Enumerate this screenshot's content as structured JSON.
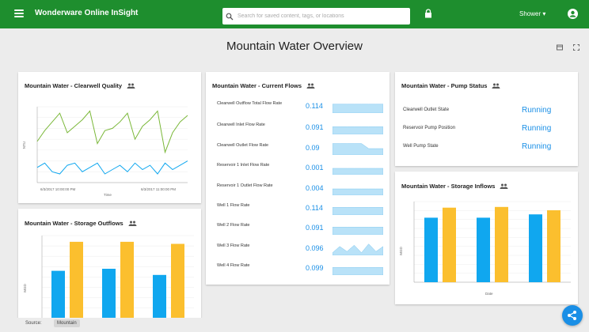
{
  "header": {
    "app_title": "Wonderware Online InSight",
    "search_placeholder": "Search for saved content, tags, or locations",
    "user_label": "Shower ▾"
  },
  "page": {
    "title": "Mountain Water Overview"
  },
  "clearwell_card": {
    "title": "Mountain Water - Clearwell Quality",
    "ylabel": "NTU",
    "x_start": "6/3/2017 10:00:00 PM",
    "x_end": "6/3/2017 11:00:00 PM",
    "xlabel": "Time"
  },
  "current_flows_card": {
    "title": "Mountain Water - Current Flows",
    "rows": [
      {
        "label": "Clearwell Outflow Total Flow Rate",
        "value": "0.114"
      },
      {
        "label": "Clearwell Inlet Flow Rate",
        "value": "0.091"
      },
      {
        "label": "Clearwell Outlet Flow Rate",
        "value": "0.09"
      },
      {
        "label": "Reservoir 1 Inlet Flow Rate",
        "value": "0.001"
      },
      {
        "label": "Reservoir 1 Outlet Flow Rate",
        "value": "0.004"
      },
      {
        "label": "Well 1 Flow Rate",
        "value": "0.114"
      },
      {
        "label": "Well 2 Flow Rate",
        "value": "0.091"
      },
      {
        "label": "Well 3 Flow Rate",
        "value": "0.096"
      },
      {
        "label": "Well 4 Flow Rate",
        "value": "0.099"
      }
    ]
  },
  "pump_status_card": {
    "title": "Mountain Water - Pump Status",
    "rows": [
      {
        "label": "Clearwell Outlet State",
        "value": "Running"
      },
      {
        "label": "Reservoir Pump Position",
        "value": "Running"
      },
      {
        "label": "Well Pump State",
        "value": "Running"
      }
    ]
  },
  "storage_outflows_card": {
    "title": "Mountain Water - Storage Outflows",
    "ylabel": "MGD"
  },
  "storage_inflows_card": {
    "title": "Mountain Water - Storage Inflows",
    "ylabel": "MGD",
    "xlabel": "Date"
  },
  "footer": {
    "label": "Source:",
    "chip": "Mountain"
  },
  "colors": {
    "brand_green": "#1e8e2e",
    "series_blue": "#10a7ef",
    "series_orange": "#fbbf2e",
    "line_green": "#7bb83a",
    "value_blue": "#1a8fe6"
  },
  "chart_data": [
    {
      "type": "line",
      "title": "Mountain Water - Clearwell Quality",
      "xlabel": "Time",
      "ylabel": "NTU",
      "x": [
        0,
        1,
        2,
        3,
        4,
        5,
        6,
        7,
        8,
        9,
        10,
        11,
        12,
        13,
        14,
        15,
        16,
        17,
        18,
        19,
        20
      ],
      "series": [
        {
          "values": [
            1.9,
            2.4,
            2.8,
            3.2,
            2.3,
            2.6,
            2.9,
            3.3,
            1.8,
            2.4,
            2.5,
            2.8,
            3.2,
            2.0,
            2.6,
            2.9,
            3.3,
            1.4,
            2.3,
            2.8,
            3.1
          ]
        },
        {
          "values": [
            0.7,
            0.9,
            0.5,
            0.4,
            0.8,
            0.9,
            0.5,
            0.7,
            0.9,
            0.4,
            0.6,
            0.8,
            0.5,
            0.9,
            0.6,
            0.8,
            0.4,
            0.9,
            0.6,
            0.8,
            1.0
          ]
        }
      ],
      "ylim": [
        0,
        3.5
      ]
    },
    {
      "type": "bar",
      "title": "Mountain Water - Storage Outflows",
      "ylabel": "MGD",
      "series": [
        {
          "values": [
            280,
            290,
            260
          ]
        },
        {
          "values": [
            420,
            420,
            410
          ]
        }
      ],
      "ylim": [
        0,
        450
      ]
    },
    {
      "type": "bar",
      "title": "Mountain Water - Storage Inflows",
      "ylabel": "MGD",
      "xlabel": "Date",
      "series": [
        {
          "values": [
            480,
            480,
            505
          ]
        },
        {
          "values": [
            555,
            560,
            535
          ]
        }
      ],
      "ylim": [
        0,
        600
      ]
    }
  ]
}
